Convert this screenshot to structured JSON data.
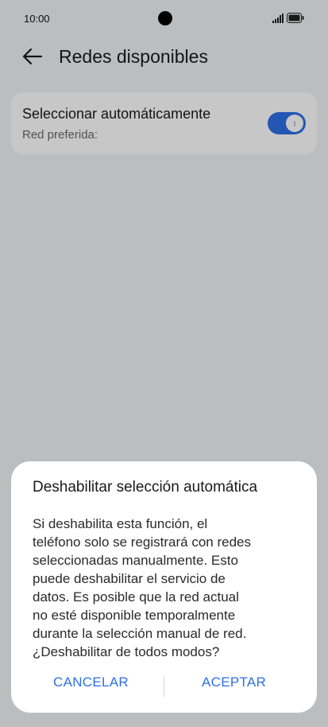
{
  "status_bar": {
    "time": "10:00"
  },
  "header": {
    "title": "Redes disponibles"
  },
  "auto_select": {
    "title": "Seleccionar automáticamente",
    "subtitle": "Red preferida:",
    "enabled": true
  },
  "dialog": {
    "title": "Deshabilitar selección automática",
    "body_lines": [
      "Si deshabilita esta función, el",
      "teléfono solo se registrará con redes",
      "seleccionadas manualmente. Esto",
      "puede deshabilitar el servicio de",
      "datos. Es posible que la red actual",
      "no esté disponible temporalmente",
      "durante la selección manual de red.",
      "¿Deshabilitar de todos modos?"
    ],
    "cancel_label": "CANCELAR",
    "accept_label": "ACEPTAR"
  },
  "colors": {
    "accent": "#2f6fe6",
    "background": "#f1f2f4"
  },
  "icons": {
    "back": "arrow-left-icon",
    "signal": "signal-icon",
    "battery": "battery-icon"
  }
}
